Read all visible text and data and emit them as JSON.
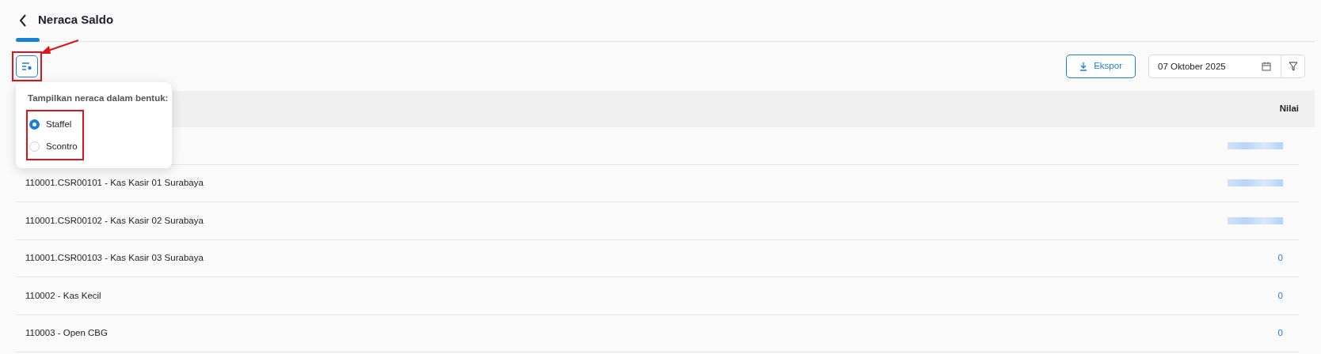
{
  "header": {
    "title": "Neraca Saldo"
  },
  "toolbar": {
    "display_button": {
      "highlighted": true,
      "pointed_at": true
    },
    "export_label": "Ekspor",
    "date_value": "07 Oktober 2025"
  },
  "popover": {
    "heading": "Tampilkan neraca dalam bentuk:",
    "highlighted": true,
    "options": [
      {
        "label": "Staffel",
        "selected": true
      },
      {
        "label": "Scontro",
        "selected": false
      }
    ]
  },
  "table": {
    "columns": [
      "Nilai"
    ],
    "rows": [
      {
        "redacted": true
      },
      {
        "account": "110001.CSR00101 - Kas Kasir 01 Surabaya",
        "redacted": true
      },
      {
        "account": "110001.CSR00102 - Kas Kasir 02 Surabaya",
        "redacted": true
      },
      {
        "account": "110001.CSR00103 - Kas Kasir 03 Surabaya",
        "redacted": false,
        "value": "0"
      },
      {
        "account": "110002 - Kas Kecil",
        "redacted": false,
        "value": "0"
      },
      {
        "account": "110003 - Open CBG",
        "redacted": false,
        "value": "0"
      }
    ]
  }
}
